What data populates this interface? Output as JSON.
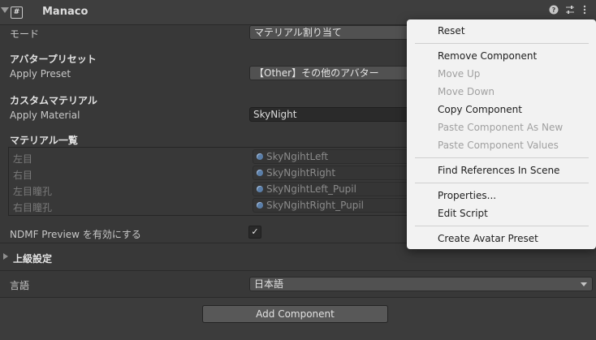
{
  "header": {
    "title": "Manaco",
    "icons": [
      "help-icon",
      "sliders-icon",
      "more-vertical-icon"
    ]
  },
  "fields": {
    "mode_label": "モード",
    "mode_value": "マテリアル割り当て",
    "avatar_preset_section": "アバタープリセット",
    "apply_preset_label": "Apply Preset",
    "apply_preset_value": "【Other】その他のアバター",
    "custom_material_section": "カスタムマテリアル",
    "apply_material_label": "Apply Material",
    "apply_material_value": "SkyNight",
    "material_list_section": "マテリアル一覧",
    "ndmf_preview_label": "NDMF Preview を有効にする",
    "ndmf_preview_checked": "✓",
    "advanced_section": "上級設定",
    "language_label": "言語",
    "language_value": "日本語"
  },
  "material_list": [
    {
      "label": "左目",
      "value": "SkyNgihtLeft"
    },
    {
      "label": "右目",
      "value": "SkyNgihtRight"
    },
    {
      "label": "左目瞳孔",
      "value": "SkyNgihtLeft_Pupil"
    },
    {
      "label": "右目瞳孔",
      "value": "SkyNgihtRight_Pupil"
    }
  ],
  "footer": {
    "add_component": "Add Component"
  },
  "context_menu": {
    "items": [
      {
        "label": "Reset",
        "enabled": true
      },
      {
        "label": "Remove Component",
        "enabled": true
      },
      {
        "label": "Move Up",
        "enabled": false
      },
      {
        "label": "Move Down",
        "enabled": false
      },
      {
        "label": "Copy Component",
        "enabled": true
      },
      {
        "label": "Paste Component As New",
        "enabled": false
      },
      {
        "label": "Paste Component Values",
        "enabled": false
      },
      {
        "label": "Find References In Scene",
        "enabled": true
      },
      {
        "label": "Properties...",
        "enabled": true
      },
      {
        "label": "Edit Script",
        "enabled": true
      },
      {
        "label": "Create Avatar Preset",
        "enabled": true
      }
    ]
  }
}
